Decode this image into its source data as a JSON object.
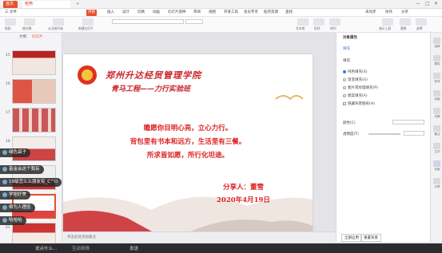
{
  "titlebar": {
    "home_tab": "首页",
    "doc_tab": "稻壳",
    "add_tab": "+"
  },
  "menu": {
    "items": [
      "三 文件",
      "开始",
      "插入",
      "设计",
      "切换",
      "动画",
      "幻灯片放映",
      "审阅",
      "视图",
      "开发工具",
      "会员专享",
      "稻壳资源",
      "查找"
    ],
    "active_index": 1,
    "right_items": [
      "未同步",
      "协作",
      "分享"
    ]
  },
  "ribbon": {
    "buttons": [
      "粘贴",
      "格式刷",
      "从当前开始",
      "新建幻灯片",
      "版式",
      "节",
      "重置"
    ],
    "right_buttons": [
      "文本框",
      "形状",
      "排列",
      "演示工具",
      "替换",
      "选择"
    ]
  },
  "left_panel": {
    "tabs": [
      "大纲",
      "幻灯片"
    ],
    "slide_numbers": [
      "15",
      "16",
      "17",
      "18",
      "19",
      "20",
      "21"
    ]
  },
  "slide": {
    "title": "郑州升达经贸管理学院",
    "subtitle": "青马工程——力行实验班",
    "lines": [
      "瞻愿你目明心亮，立心力行。",
      "背包里有书本和远方，生活里有三餐。",
      "所求皆如愿，所行化坦途。"
    ],
    "presenter": "分享人：董雪",
    "date": "2020年4月19日"
  },
  "notes": {
    "placeholder": "单击此处添加备注"
  },
  "right_panel": {
    "title": "对象属性",
    "tab": "填充",
    "section": "填充",
    "options": [
      "纯色填充(S)",
      "渐变填充(G)",
      "图片或纹理填充(P)",
      "图案填充(A)",
      "隐藏背景图形(H)"
    ],
    "selected_index": 0,
    "transparency_label": "颜色(C)",
    "transparency2_label": "透明度(T)",
    "footer_buttons": [
      "全部应用",
      "重置背景"
    ]
  },
  "right_strip": {
    "labels": [
      "选择",
      "属性",
      "形状",
      "动画",
      "切换",
      "备注",
      "文字",
      "动画",
      "分享"
    ]
  },
  "chat": {
    "messages": [
      "绿色袋子",
      "基金会这个我有",
      "19级怎么么朋友有_C^O",
      "学姐好美",
      "倒为人理念",
      "哈哈哈"
    ],
    "input_placeholder": "说点什么...",
    "emoji_label": "互动表情",
    "send_label": "发送"
  },
  "colors": {
    "accent": "#e7502e",
    "slide_text": "#d22222",
    "status_bg": "#3d3f47"
  }
}
